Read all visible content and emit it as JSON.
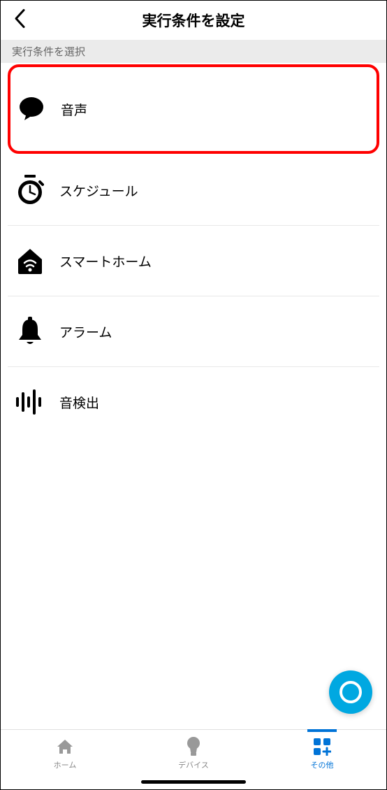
{
  "header": {
    "title": "実行条件を設定"
  },
  "section": {
    "label": "実行条件を選択"
  },
  "items": [
    {
      "label": "音声",
      "icon": "speech-bubble-icon",
      "highlighted": true
    },
    {
      "label": "スケジュール",
      "icon": "clock-icon",
      "highlighted": false
    },
    {
      "label": "スマートホーム",
      "icon": "smarthome-icon",
      "highlighted": false
    },
    {
      "label": "アラーム",
      "icon": "alarm-icon",
      "highlighted": false
    },
    {
      "label": "音検出",
      "icon": "sound-wave-icon",
      "highlighted": false
    }
  ],
  "nav": {
    "home": "ホーム",
    "devices": "デバイス",
    "more": "その他"
  },
  "colors": {
    "highlight": "#ff0000",
    "accent": "#00a8e1",
    "active": "#0073d7"
  }
}
